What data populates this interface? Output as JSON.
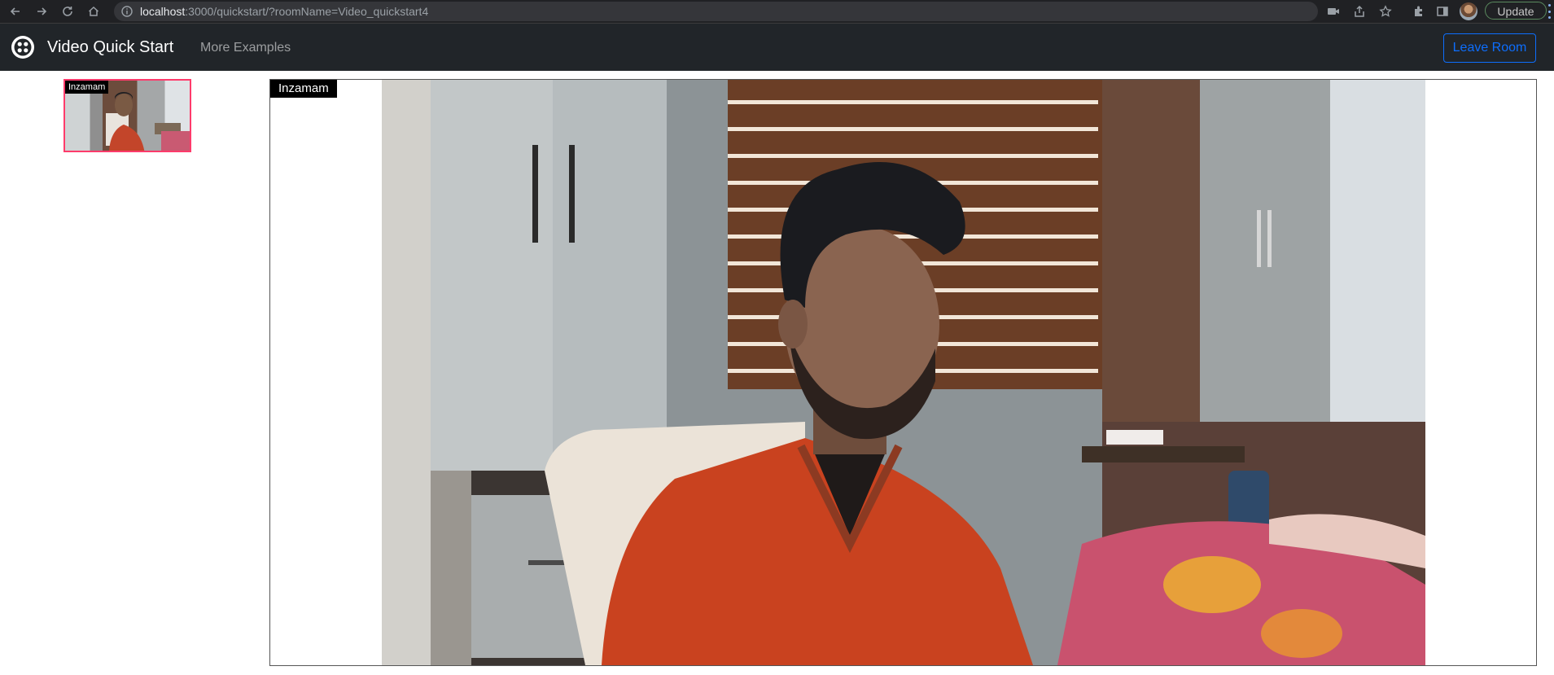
{
  "browser": {
    "url_host": "localhost",
    "url_path": ":3000/quickstart/?roomName=Video_quickstart4",
    "update_label": "Update"
  },
  "navbar": {
    "brand_name": "Video Quick Start",
    "more_examples_label": "More Examples",
    "leave_room_label": "Leave Room"
  },
  "local_participant": {
    "name": "Inzamam"
  },
  "main_participant": {
    "name": "Inzamam"
  },
  "colors": {
    "navbar_bg": "#212529",
    "leave_button": "#0d6efd",
    "local_border": "#ff3b6b"
  }
}
